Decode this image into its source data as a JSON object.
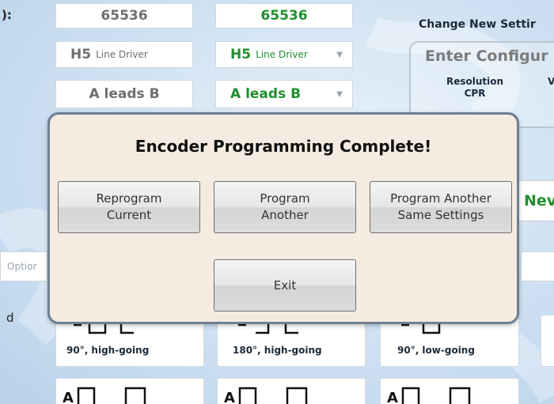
{
  "background": {
    "top_left_label": "):",
    "resolution_current": "65536",
    "resolution_new": "65536",
    "output_current": {
      "big": "H5",
      "small": "Line Driver"
    },
    "output_new": {
      "big": "H5",
      "small": "Line Driver"
    },
    "phase_current": "A leads B",
    "phase_new": "A leads B",
    "change_title": "Change New Settir",
    "config_title": "Enter Configur",
    "resolution_label": "Resolution CPR",
    "v_label": "V",
    "new_button": "Nev",
    "option_label": "Optior",
    "d_label": "d",
    "phase_cards": [
      {
        "caption": "90°, high-going"
      },
      {
        "caption": "180°, high-going"
      },
      {
        "caption": "90°, low-going"
      }
    ],
    "wave_letter": "A"
  },
  "modal": {
    "title": "Encoder Programming Complete!",
    "buttons": {
      "reprogram": [
        "Reprogram",
        "Current"
      ],
      "program_another": [
        "Program",
        "Another"
      ],
      "program_same": [
        "Program Another",
        "Same Settings"
      ],
      "exit": "Exit"
    }
  },
  "colors": {
    "accent_green": "#1f8f2e",
    "modal_bg": "#f6ebe1",
    "modal_border": "#6d7f93"
  }
}
